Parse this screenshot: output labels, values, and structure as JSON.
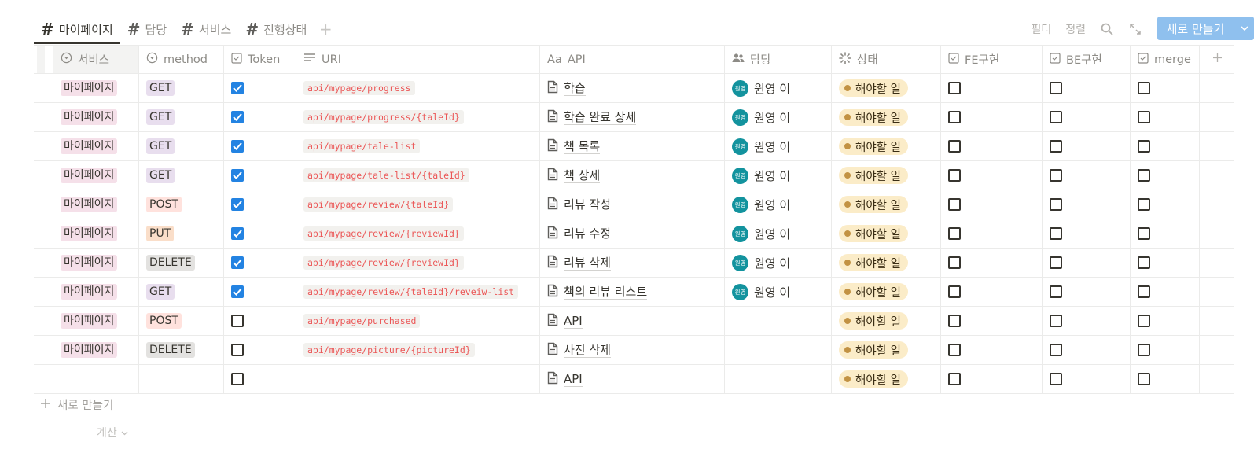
{
  "tabs": [
    {
      "label": "마이페이지",
      "active": true
    },
    {
      "label": "담당",
      "active": false
    },
    {
      "label": "서비스",
      "active": false
    },
    {
      "label": "진행상태",
      "active": false
    }
  ],
  "toolbar": {
    "filter_label": "필터",
    "sort_label": "정렬",
    "new_label": "새로 만들기"
  },
  "columns": {
    "service": "서비스",
    "method": "method",
    "token": "Token",
    "uri": "URI",
    "api": "API",
    "api_prefix": "Aa",
    "owner": "담당",
    "status": "상태",
    "fe": "FE구현",
    "be": "BE구현",
    "merge": "merge"
  },
  "rows": [
    {
      "service": "마이페이지",
      "method": "GET",
      "method_color": "purple",
      "token": true,
      "uri": "api/mypage/progress",
      "api": "학습",
      "owner": "원영 이",
      "status": "해야할 일",
      "fe": false,
      "be": false,
      "merge": false
    },
    {
      "service": "마이페이지",
      "method": "GET",
      "method_color": "purple",
      "token": true,
      "uri": "api/mypage/progress/{taleId}",
      "api": "학습 완료 상세",
      "owner": "원영 이",
      "status": "해야할 일",
      "fe": false,
      "be": false,
      "merge": false
    },
    {
      "service": "마이페이지",
      "method": "GET",
      "method_color": "purple",
      "token": true,
      "uri": "api/mypage/tale-list",
      "api": "책 목록",
      "owner": "원영 이",
      "status": "해야할 일",
      "fe": false,
      "be": false,
      "merge": false
    },
    {
      "service": "마이페이지",
      "method": "GET",
      "method_color": "purple",
      "token": true,
      "uri": "api/mypage/tale-list/{taleId}",
      "api": "책 상세",
      "owner": "원영 이",
      "status": "해야할 일",
      "fe": false,
      "be": false,
      "merge": false
    },
    {
      "service": "마이페이지",
      "method": "POST",
      "method_color": "red",
      "token": true,
      "uri": "api/mypage/review/{taleId}",
      "api": "리뷰 작성",
      "owner": "원영 이",
      "status": "해야할 일",
      "fe": false,
      "be": false,
      "merge": false
    },
    {
      "service": "마이페이지",
      "method": "PUT",
      "method_color": "orange",
      "token": true,
      "uri": "api/mypage/review/{reviewId}",
      "api": "리뷰 수정",
      "owner": "원영 이",
      "status": "해야할 일",
      "fe": false,
      "be": false,
      "merge": false
    },
    {
      "service": "마이페이지",
      "method": "DELETE",
      "method_color": "grey",
      "token": true,
      "uri": "api/mypage/review/{reviewId}",
      "api": "리뷰 삭제",
      "owner": "원영 이",
      "status": "해야할 일",
      "fe": false,
      "be": false,
      "merge": false
    },
    {
      "service": "마이페이지",
      "method": "GET",
      "method_color": "purple",
      "token": true,
      "uri": "api/mypage/review/{taleId}/reveiw-list",
      "api": "책의 리뷰 리스트",
      "owner": "원영 이",
      "status": "해야할 일",
      "fe": false,
      "be": false,
      "merge": false
    },
    {
      "service": "마이페이지",
      "method": "POST",
      "method_color": "red",
      "token": false,
      "uri": "api/mypage/purchased",
      "api": "API",
      "owner": "",
      "status": "해야할 일",
      "fe": false,
      "be": false,
      "merge": false
    },
    {
      "service": "마이페이지",
      "method": "DELETE",
      "method_color": "grey",
      "token": false,
      "uri": "api/mypage/picture/{pictureId}",
      "api": "사진 삭제",
      "owner": "",
      "status": "해야할 일",
      "fe": false,
      "be": false,
      "merge": false
    },
    {
      "service": "",
      "method": "",
      "method_color": "",
      "token": false,
      "uri": "",
      "api": "API",
      "owner": "",
      "status": "해야할 일",
      "fe": false,
      "be": false,
      "merge": false
    }
  ],
  "avatar_text": "원영",
  "new_row_label": "새로 만들기",
  "calc_label": "계산",
  "colors": {
    "accent": "#2383e2",
    "new_button": "#8fc0ee",
    "avatar": "#13939e",
    "status_bg": "#fbecc8",
    "status_dot": "#c29243",
    "code_text": "#eb5757"
  }
}
